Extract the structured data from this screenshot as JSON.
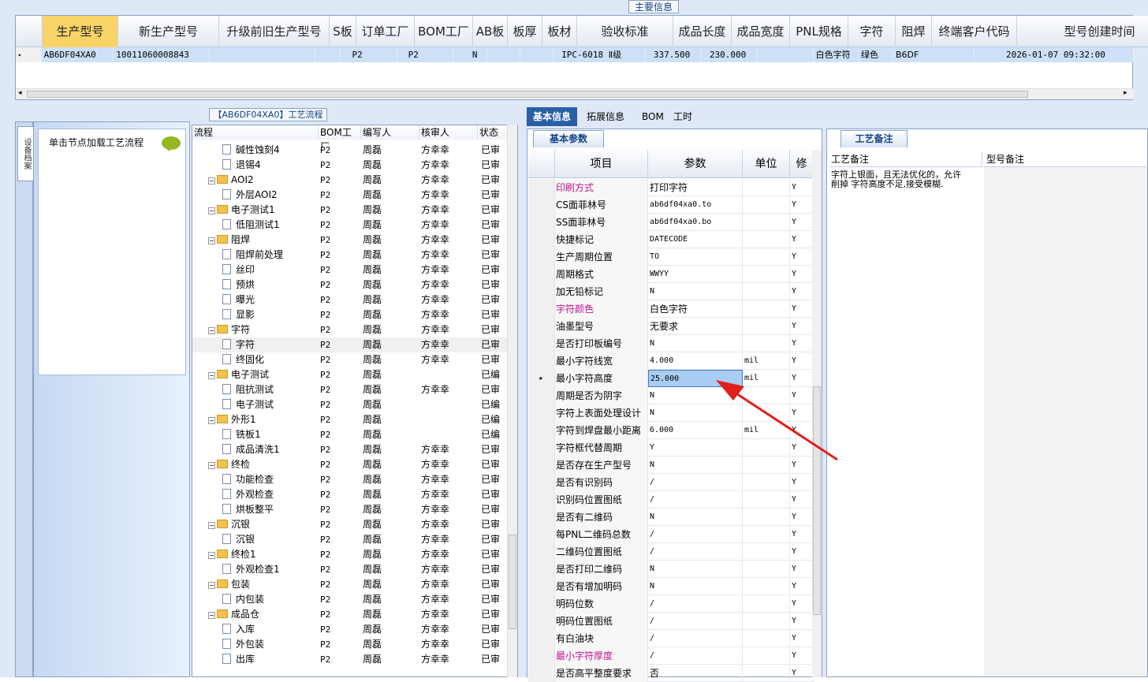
{
  "main_info": {
    "title": "主要信息",
    "columns": [
      "生产型号",
      "新生产型号",
      "升级前旧生产型号",
      "S板",
      "订单工厂",
      "BOM工厂",
      "AB板",
      "板厚",
      "板材",
      "验收标准",
      "成品长度",
      "成品宽度",
      "PNL规格",
      "字符",
      "阻焊",
      "终端客户代码",
      "型号创建时间"
    ],
    "row": {
      "indicator": "▸",
      "production_model": "AB6DF04XA0",
      "new_model": "10011060008843",
      "old_model": "",
      "s_board": "",
      "order_factory": "P2",
      "bom_factory": "P2",
      "ab_board": "N",
      "thickness": "",
      "material": "",
      "standard": "IPC-6018 Ⅱ级",
      "length": "337.500",
      "width": "230.000",
      "pnl": "",
      "legend": "白色字符",
      "solder_mask": "绿色",
      "customer_code": "B6DF",
      "created_at": "2026-01-07 09:32:00"
    }
  },
  "flow": {
    "title": "【AB6DF04XA0】工艺流程",
    "side_tab": "设备档案",
    "tip": "单击节点加载工艺流程",
    "columns": [
      "流程",
      "BOM工厂",
      "编写人",
      "核审人",
      "状态"
    ],
    "rows": [
      {
        "name": "碱性蚀刻4",
        "type": "doc",
        "level": 2,
        "factory": "P2",
        "writer": "周磊",
        "reviewer": "方幸幸",
        "status": "已审"
      },
      {
        "name": "退锡4",
        "type": "doc",
        "level": 2,
        "factory": "P2",
        "writer": "周磊",
        "reviewer": "方幸幸",
        "status": "已审"
      },
      {
        "name": "AOI2",
        "type": "folder",
        "level": 1,
        "factory": "P2",
        "writer": "周磊",
        "reviewer": "方幸幸",
        "status": "已审"
      },
      {
        "name": "外层AOI2",
        "type": "doc",
        "level": 2,
        "factory": "P2",
        "writer": "周磊",
        "reviewer": "方幸幸",
        "status": "已审"
      },
      {
        "name": "电子测试1",
        "type": "folder",
        "level": 1,
        "factory": "P2",
        "writer": "周磊",
        "reviewer": "方幸幸",
        "status": "已审"
      },
      {
        "name": "低阻测试1",
        "type": "doc",
        "level": 2,
        "factory": "P2",
        "writer": "周磊",
        "reviewer": "方幸幸",
        "status": "已审"
      },
      {
        "name": "阻焊",
        "type": "folder",
        "level": 1,
        "factory": "P2",
        "writer": "周磊",
        "reviewer": "方幸幸",
        "status": "已审"
      },
      {
        "name": "阻焊前处理",
        "type": "doc",
        "level": 2,
        "factory": "P2",
        "writer": "周磊",
        "reviewer": "方幸幸",
        "status": "已审"
      },
      {
        "name": "丝印",
        "type": "doc",
        "level": 2,
        "factory": "P2",
        "writer": "周磊",
        "reviewer": "方幸幸",
        "status": "已审"
      },
      {
        "name": "预烘",
        "type": "doc",
        "level": 2,
        "factory": "P2",
        "writer": "周磊",
        "reviewer": "方幸幸",
        "status": "已审"
      },
      {
        "name": "曝光",
        "type": "doc",
        "level": 2,
        "factory": "P2",
        "writer": "周磊",
        "reviewer": "方幸幸",
        "status": "已审"
      },
      {
        "name": "显影",
        "type": "doc",
        "level": 2,
        "factory": "P2",
        "writer": "周磊",
        "reviewer": "方幸幸",
        "status": "已审"
      },
      {
        "name": "字符",
        "type": "folder",
        "level": 1,
        "factory": "P2",
        "writer": "周磊",
        "reviewer": "方幸幸",
        "status": "已审"
      },
      {
        "name": "字符",
        "type": "doc",
        "level": 2,
        "factory": "P2",
        "writer": "周磊",
        "reviewer": "方幸幸",
        "status": "已审",
        "selected": true
      },
      {
        "name": "终固化",
        "type": "doc",
        "level": 2,
        "factory": "P2",
        "writer": "周磊",
        "reviewer": "方幸幸",
        "status": "已审"
      },
      {
        "name": "电子测试",
        "type": "folder",
        "level": 1,
        "factory": "P2",
        "writer": "周磊",
        "reviewer": "",
        "status": "已编"
      },
      {
        "name": "阻抗测试",
        "type": "doc",
        "level": 2,
        "factory": "P2",
        "writer": "周磊",
        "reviewer": "方幸幸",
        "status": "已审"
      },
      {
        "name": "电子测试",
        "type": "doc",
        "level": 2,
        "factory": "P2",
        "writer": "周磊",
        "reviewer": "",
        "status": "已编"
      },
      {
        "name": "外形1",
        "type": "folder",
        "level": 1,
        "factory": "P2",
        "writer": "周磊",
        "reviewer": "",
        "status": "已编"
      },
      {
        "name": "铣板1",
        "type": "doc",
        "level": 2,
        "factory": "P2",
        "writer": "周磊",
        "reviewer": "",
        "status": "已编"
      },
      {
        "name": "成品清洗1",
        "type": "doc",
        "level": 2,
        "factory": "P2",
        "writer": "周磊",
        "reviewer": "方幸幸",
        "status": "已审"
      },
      {
        "name": "终检",
        "type": "folder",
        "level": 1,
        "factory": "P2",
        "writer": "周磊",
        "reviewer": "方幸幸",
        "status": "已审"
      },
      {
        "name": "功能检查",
        "type": "doc",
        "level": 2,
        "factory": "P2",
        "writer": "周磊",
        "reviewer": "方幸幸",
        "status": "已审"
      },
      {
        "name": "外观检查",
        "type": "doc",
        "level": 2,
        "factory": "P2",
        "writer": "周磊",
        "reviewer": "方幸幸",
        "status": "已审"
      },
      {
        "name": "烘板整平",
        "type": "doc",
        "level": 2,
        "factory": "P2",
        "writer": "周磊",
        "reviewer": "方幸幸",
        "status": "已审"
      },
      {
        "name": "沉银",
        "type": "folder",
        "level": 1,
        "factory": "P2",
        "writer": "周磊",
        "reviewer": "方幸幸",
        "status": "已审"
      },
      {
        "name": "沉银",
        "type": "doc",
        "level": 2,
        "factory": "P2",
        "writer": "周磊",
        "reviewer": "方幸幸",
        "status": "已审"
      },
      {
        "name": "终检1",
        "type": "folder",
        "level": 1,
        "factory": "P2",
        "writer": "周磊",
        "reviewer": "方幸幸",
        "status": "已审"
      },
      {
        "name": "外观检查1",
        "type": "doc",
        "level": 2,
        "factory": "P2",
        "writer": "周磊",
        "reviewer": "方幸幸",
        "status": "已审"
      },
      {
        "name": "包装",
        "type": "folder",
        "level": 1,
        "factory": "P2",
        "writer": "周磊",
        "reviewer": "方幸幸",
        "status": "已审"
      },
      {
        "name": "内包装",
        "type": "doc",
        "level": 2,
        "factory": "P2",
        "writer": "周磊",
        "reviewer": "方幸幸",
        "status": "已审"
      },
      {
        "name": "成品仓",
        "type": "folder",
        "level": 1,
        "factory": "P2",
        "writer": "周磊",
        "reviewer": "方幸幸",
        "status": "已审"
      },
      {
        "name": "入库",
        "type": "doc",
        "level": 2,
        "factory": "P2",
        "writer": "周磊",
        "reviewer": "方幸幸",
        "status": "已审"
      },
      {
        "name": "外包装",
        "type": "doc",
        "level": 2,
        "factory": "P2",
        "writer": "周磊",
        "reviewer": "方幸幸",
        "status": "已审"
      },
      {
        "name": "出库",
        "type": "doc",
        "level": 2,
        "factory": "P2",
        "writer": "周磊",
        "reviewer": "方幸幸",
        "status": "已审"
      }
    ]
  },
  "right_tabs": [
    "基本信息",
    "拓展信息",
    "BOM",
    "工时"
  ],
  "basic": {
    "tab": "基本参数",
    "columns": [
      "项目",
      "参数",
      "单位",
      "修"
    ],
    "rows": [
      {
        "item": "印刷方式",
        "value": "打印字符",
        "unit": "",
        "mod": "Y",
        "pink": true
      },
      {
        "item": "CS面菲林号",
        "value": "ab6df04xa0.to",
        "unit": "",
        "mod": "Y"
      },
      {
        "item": "SS面菲林号",
        "value": "ab6df04xa0.bo",
        "unit": "",
        "mod": "Y"
      },
      {
        "item": "快捷标记",
        "value": "DATECODE",
        "unit": "",
        "mod": "Y"
      },
      {
        "item": "生产周期位置",
        "value": "TO",
        "unit": "",
        "mod": "Y"
      },
      {
        "item": "周期格式",
        "value": "WWYY",
        "unit": "",
        "mod": "Y"
      },
      {
        "item": "加无铅标记",
        "value": "N",
        "unit": "",
        "mod": "Y"
      },
      {
        "item": "字符颜色",
        "value": "白色字符",
        "unit": "",
        "mod": "Y",
        "pink": true
      },
      {
        "item": "油墨型号",
        "value": "无要求",
        "unit": "",
        "mod": "Y"
      },
      {
        "item": "是否打印板编号",
        "value": "N",
        "unit": "",
        "mod": "Y"
      },
      {
        "item": "最小字符线宽",
        "value": "4.000",
        "unit": "mil",
        "mod": "Y"
      },
      {
        "item": "最小字符高度",
        "value": "25.000",
        "unit": "mil",
        "mod": "Y",
        "selected": true
      },
      {
        "item": "周期是否为阴字",
        "value": "N",
        "unit": "",
        "mod": "Y"
      },
      {
        "item": "字符上表面处理设计",
        "value": "N",
        "unit": "",
        "mod": "Y"
      },
      {
        "item": "字符到焊盘最小距离",
        "value": "6.000",
        "unit": "mil",
        "mod": "Y"
      },
      {
        "item": "字符框代替周期",
        "value": "Y",
        "unit": "",
        "mod": "Y"
      },
      {
        "item": "是否存在生产型号",
        "value": "N",
        "unit": "",
        "mod": "Y"
      },
      {
        "item": "是否有识别码",
        "value": "/",
        "unit": "",
        "mod": "Y"
      },
      {
        "item": "识别码位置图纸",
        "value": "/",
        "unit": "",
        "mod": "Y"
      },
      {
        "item": "是否有二维码",
        "value": "N",
        "unit": "",
        "mod": "Y"
      },
      {
        "item": "每PNL二维码总数",
        "value": "/",
        "unit": "",
        "mod": "Y"
      },
      {
        "item": "二维码位置图纸",
        "value": "/",
        "unit": "",
        "mod": "Y"
      },
      {
        "item": "是否打印二维码",
        "value": "N",
        "unit": "",
        "mod": "Y"
      },
      {
        "item": "是否有增加明码",
        "value": "N",
        "unit": "",
        "mod": "Y"
      },
      {
        "item": "明码位数",
        "value": "/",
        "unit": "",
        "mod": "Y"
      },
      {
        "item": "明码位置图纸",
        "value": "/",
        "unit": "",
        "mod": "Y"
      },
      {
        "item": "有白油块",
        "value": "/",
        "unit": "",
        "mod": "Y"
      },
      {
        "item": "最小字符厚度",
        "value": "/",
        "unit": "",
        "mod": "Y",
        "pink": true
      },
      {
        "item": "是否高平整度要求",
        "value": "否",
        "unit": "",
        "mod": "Y"
      }
    ]
  },
  "remarks": {
    "tab": "工艺备注",
    "col1": "工艺备注",
    "col2": "型号备注",
    "text": "字符上银面，且无法优化的，允许削掉 字符高度不足,接受模糊."
  },
  "colors": {
    "accent": "#2a5fa8",
    "pink": "#c0158c",
    "arrow": "#e0201c",
    "selected_header": "#f8d468"
  }
}
